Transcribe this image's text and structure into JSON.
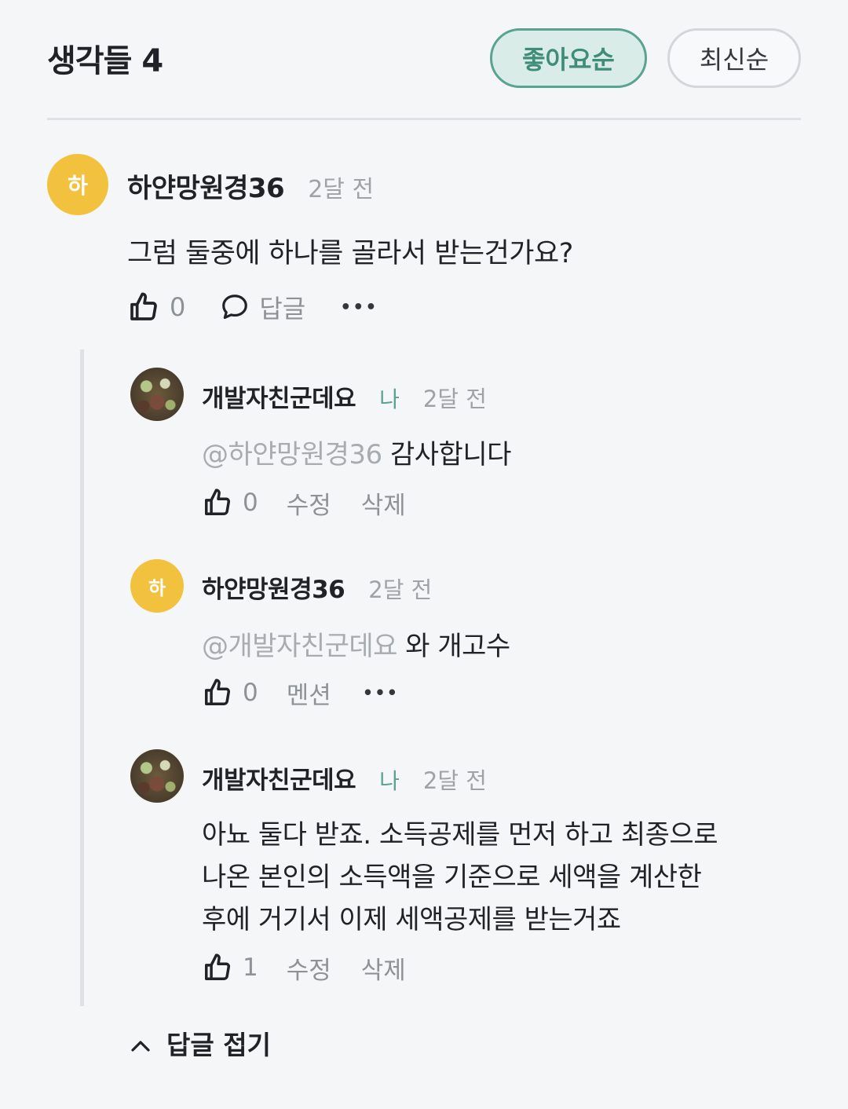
{
  "header": {
    "title": "생각들 4",
    "sort_popular": "좋아요순",
    "sort_latest": "최신순"
  },
  "comments": [
    {
      "avatar_letter": "하",
      "author": "하얀망원경36",
      "time": "2달 전",
      "text": "그럼 둘중에 하나를 골라서 받는건가요?",
      "likes": "0",
      "reply_label": "답글",
      "more": "•••"
    }
  ],
  "replies": [
    {
      "author": "개발자친군데요",
      "me_tag": "나",
      "time": "2달 전",
      "mention": "@하얀망원경36",
      "text": "감사합니다",
      "likes": "0",
      "edit_label": "수정",
      "delete_label": "삭제"
    },
    {
      "avatar_letter": "하",
      "author": "하얀망원경36",
      "time": "2달 전",
      "mention": "@개발자친군데요",
      "text": "와 개고수",
      "likes": "0",
      "mention_label": "멘션",
      "more": "•••"
    },
    {
      "author": "개발자친군데요",
      "me_tag": "나",
      "time": "2달 전",
      "lines": [
        "아뇨 둘다 받죠. 소득공제를 먼저 하고 최종으로",
        "나온 본인의 소득액을 기준으로 세액을 계산한",
        "후에 거기서 이제 세액공제를 받는거죠"
      ],
      "likes": "1",
      "edit_label": "수정",
      "delete_label": "삭제"
    }
  ],
  "collapse_label": "답글 접기",
  "icons": [
    "thumbs-up-icon",
    "speech-bubble-icon",
    "chevron-up-icon",
    "more-icon"
  ],
  "colors": {
    "accent": "#5aa391",
    "avatar_yellow": "#f2c13d",
    "muted": "#9ea3a8"
  }
}
